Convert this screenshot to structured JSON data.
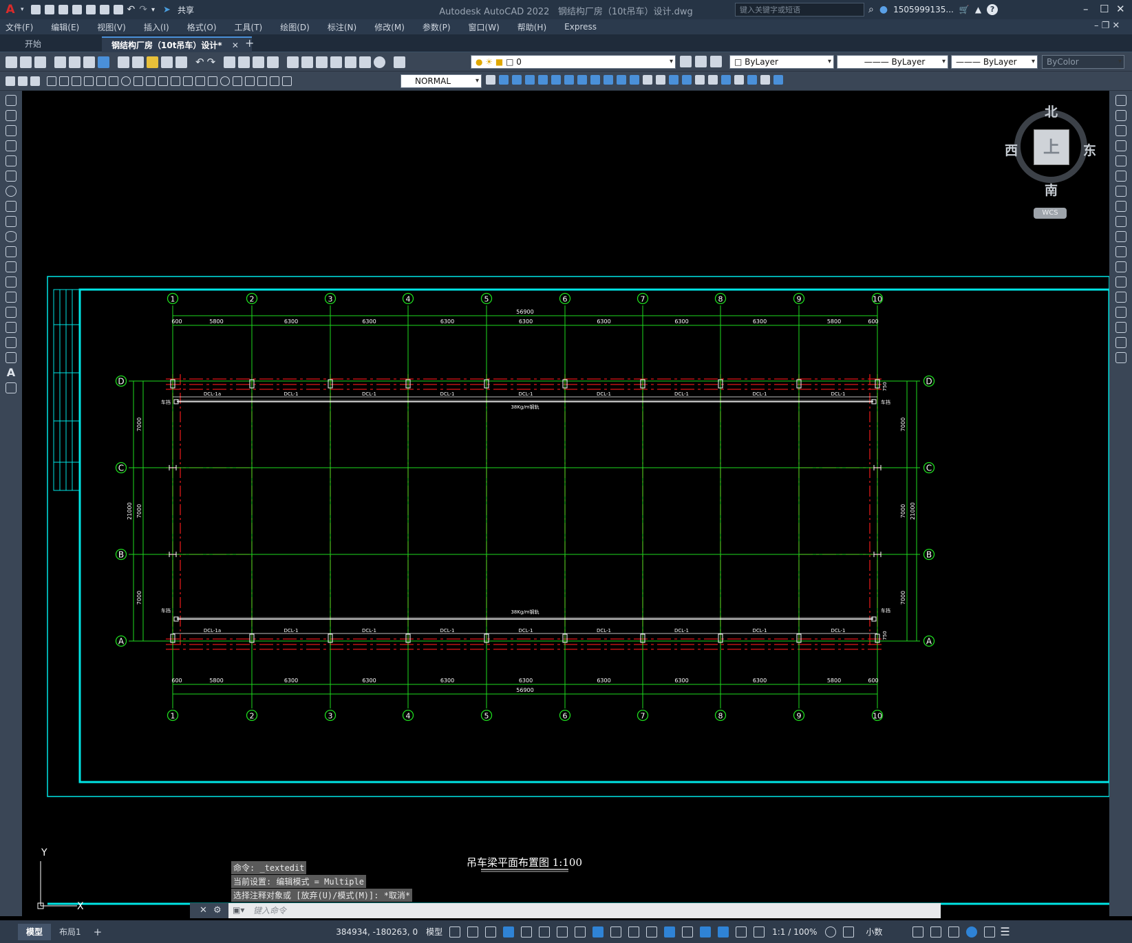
{
  "app_title": "Autodesk AutoCAD 2022",
  "file_title": "钢结构厂房（10t吊车）设计.dwg",
  "share_label": "共享",
  "search_placeholder": "键入关键字或短语",
  "username": "1505999135...",
  "menus": [
    "文件(F)",
    "编辑(E)",
    "视图(V)",
    "插入(I)",
    "格式(O)",
    "工具(T)",
    "绘图(D)",
    "标注(N)",
    "修改(M)",
    "参数(P)",
    "窗口(W)",
    "帮助(H)",
    "Express"
  ],
  "tabs": {
    "start": "开始",
    "active": "钢结构厂房（10t吊车）设计*"
  },
  "layer_value": "0",
  "color_value": "ByLayer",
  "linetype_value": "ByLayer",
  "lineweight_value": "ByLayer",
  "plotstyle_value": "ByColor",
  "textstyle_value": "NORMAL",
  "viewcube": {
    "north": "北",
    "south": "南",
    "east": "东",
    "west": "西",
    "top": "上",
    "wcs": "WCS"
  },
  "ucs": {
    "x": "X",
    "y": "Y"
  },
  "drawing": {
    "grid_numbers": [
      "1",
      "2",
      "3",
      "4",
      "5",
      "6",
      "7",
      "8",
      "9",
      "10"
    ],
    "grid_letters": [
      "D",
      "C",
      "B",
      "A"
    ],
    "overall_dim": "56900",
    "bay_dims": [
      "600",
      "5800",
      "6300",
      "6300",
      "6300",
      "6300",
      "6300",
      "6300",
      "6300",
      "5800",
      "600"
    ],
    "beam_labels": [
      "DCL-1a",
      "DCL-1",
      "DCL-1",
      "DCL-1",
      "DCL-1",
      "DCL-1",
      "DCL-1",
      "DCL-1",
      "DCL-1",
      "DCL-1a"
    ],
    "rail_label": "38Kg/m钢轨",
    "stop_label": "车挡",
    "span_dims": [
      "7000",
      "7000",
      "7000"
    ],
    "total_span": "21000",
    "offset_dim": "750",
    "title": "吊车梁平面布置图 1:100"
  },
  "command_history": [
    "命令: _textedit",
    "当前设置: 编辑模式 = Multiple",
    "选择注释对象或 [放弃(U)/模式(M)]: *取消*"
  ],
  "command_placeholder": "键入命令",
  "status": {
    "model_tab": "模型",
    "layout_tab": "布局1",
    "coords": "384934, -180263, 0",
    "space": "模型",
    "scale": "1:1 / 100%",
    "units": "小数"
  }
}
